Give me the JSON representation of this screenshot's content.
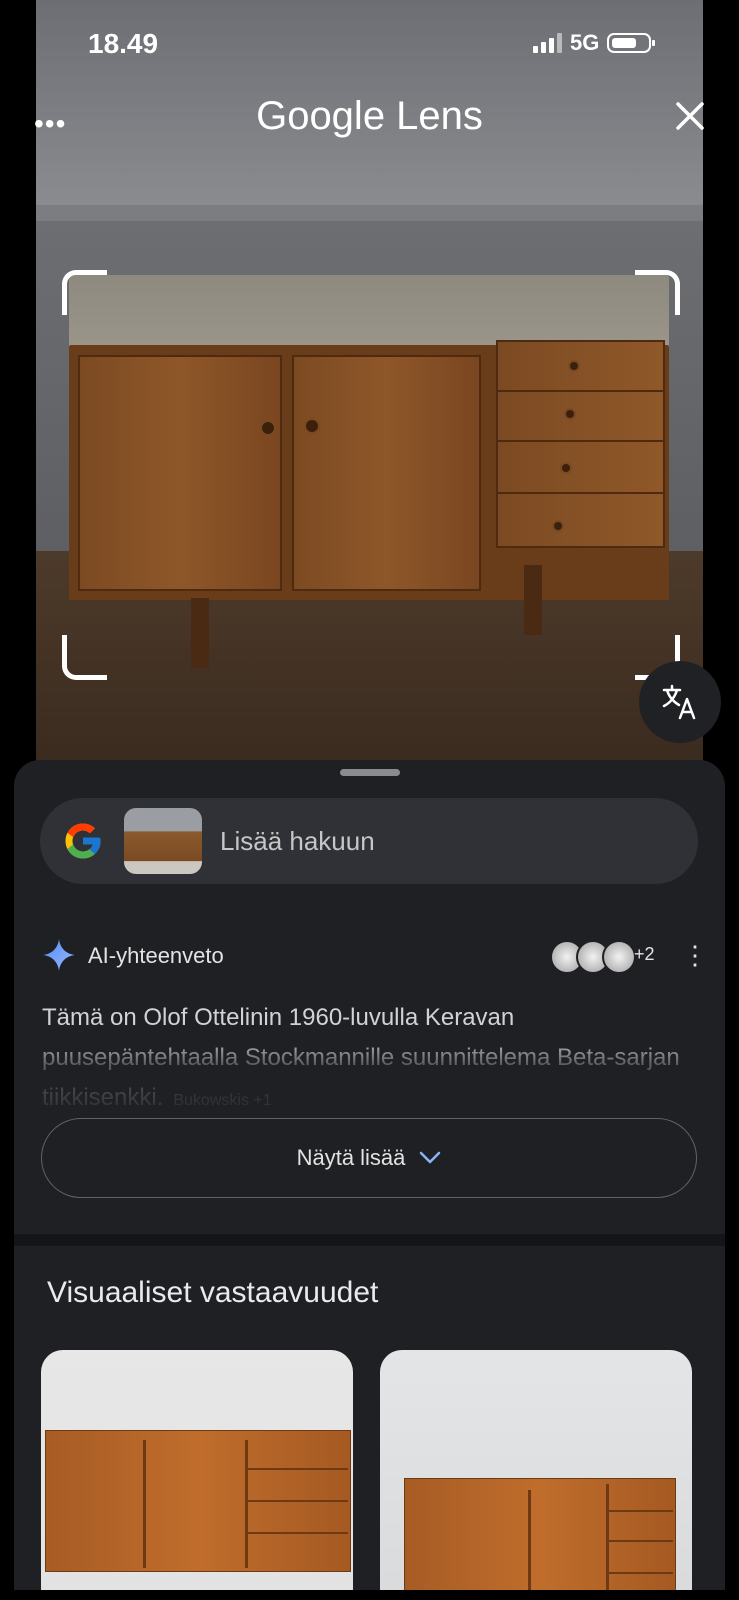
{
  "status_bar": {
    "time": "18.49",
    "network": "5G"
  },
  "header": {
    "title": "Google Lens",
    "more_icon": "more-horizontal-icon",
    "close_icon": "close-icon"
  },
  "translate": {
    "icon": "translate-icon"
  },
  "search": {
    "placeholder": "Lisää hakuun"
  },
  "ai_overview": {
    "label": "AI-yhteenveto",
    "sources_more": "+2",
    "text": "Tämä on Olof Ottelinin 1960-luvulla Keravan puusepäntehtaalla Stockmannille suunnittelema Beta-sarjan tiikkisenkki.",
    "source_chip": "Bukowskis +1",
    "show_more": "Näytä lisää"
  },
  "visual_matches": {
    "title": "Visuaaliset vastaavuudet"
  },
  "colors": {
    "sheet": "#1f2024",
    "accent_blue": "#8ab4f8"
  }
}
